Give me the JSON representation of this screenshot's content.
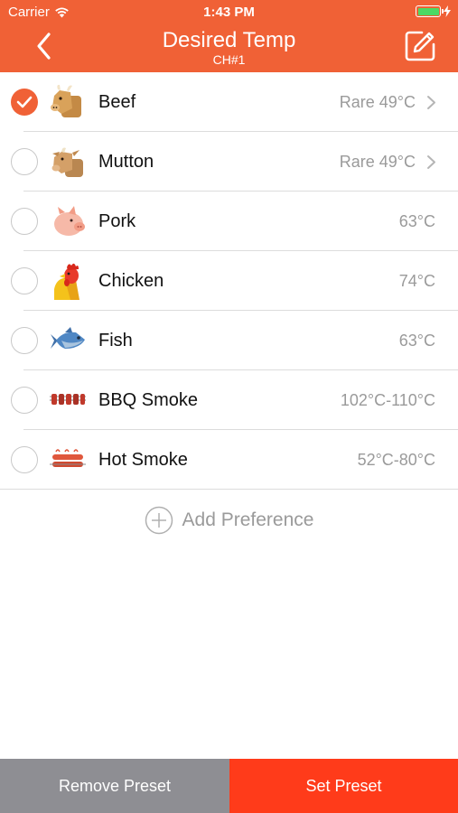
{
  "status_bar": {
    "carrier": "Carrier",
    "time": "1:43 PM",
    "battery_color": "#4cd964"
  },
  "nav": {
    "title": "Desired Temp",
    "subtitle": "CH#1",
    "back_icon": "chevron-left-icon",
    "edit_icon": "edit-icon",
    "background": "#f06136"
  },
  "presets": [
    {
      "name": "Beef",
      "temp": "Rare 49°C",
      "selected": true,
      "has_detail": true,
      "icon": "cow-icon"
    },
    {
      "name": "Mutton",
      "temp": "Rare 49°C",
      "selected": false,
      "has_detail": true,
      "icon": "goat-icon"
    },
    {
      "name": "Pork",
      "temp": "63°C",
      "selected": false,
      "has_detail": false,
      "icon": "pig-icon"
    },
    {
      "name": "Chicken",
      "temp": "74°C",
      "selected": false,
      "has_detail": false,
      "icon": "rooster-icon"
    },
    {
      "name": "Fish",
      "temp": "63°C",
      "selected": false,
      "has_detail": false,
      "icon": "fish-icon"
    },
    {
      "name": "BBQ Smoke",
      "temp": "102°C-110°C",
      "selected": false,
      "has_detail": false,
      "icon": "skewers-icon"
    },
    {
      "name": "Hot Smoke",
      "temp": "52°C-80°C",
      "selected": false,
      "has_detail": false,
      "icon": "sausage-icon"
    }
  ],
  "add_preference": {
    "label": "Add Preference",
    "icon": "plus-circle-icon"
  },
  "buttons": {
    "remove": "Remove Preset",
    "set": "Set Preset",
    "remove_color": "#8e8e93",
    "set_color": "#ff3b1a"
  },
  "accent": "#f06136"
}
